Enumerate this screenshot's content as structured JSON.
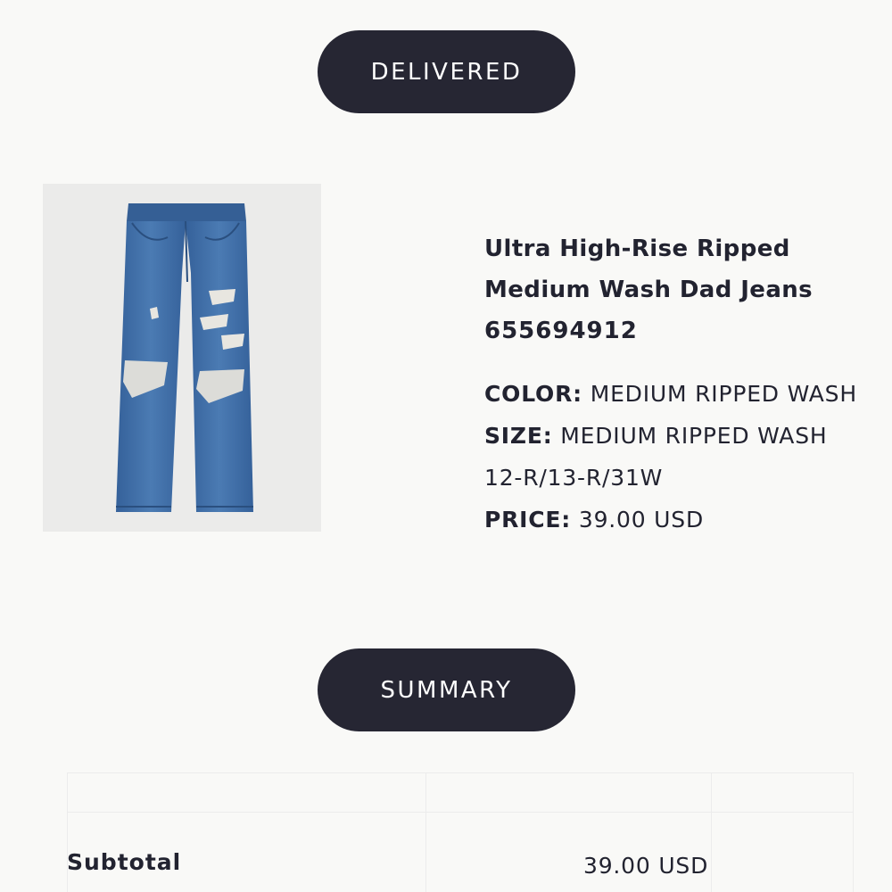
{
  "status_label": "DELIVERED",
  "product": {
    "image_alt": "ultra-high-rise-ripped-jeans-image",
    "title": "Ultra High-Rise Ripped Medium Wash Dad Jeans",
    "sku": "655694912",
    "color_label": "COLOR:",
    "color_value": "MEDIUM RIPPED WASH",
    "size_label": "SIZE:",
    "size_value": "MEDIUM RIPPED WASH 12-R/13-R/31W",
    "price_label": "PRICE:",
    "price_value": "39.00 USD"
  },
  "summary": {
    "button_label": "SUMMARY",
    "rows": [
      {
        "label": "Subtotal",
        "value": "39.00 USD"
      }
    ]
  },
  "colors": {
    "pill_background": "#262633",
    "pill_text": "#ffffff",
    "page_background": "#f9f9f7",
    "text": "#222330",
    "denim": "#3f6fa6"
  }
}
